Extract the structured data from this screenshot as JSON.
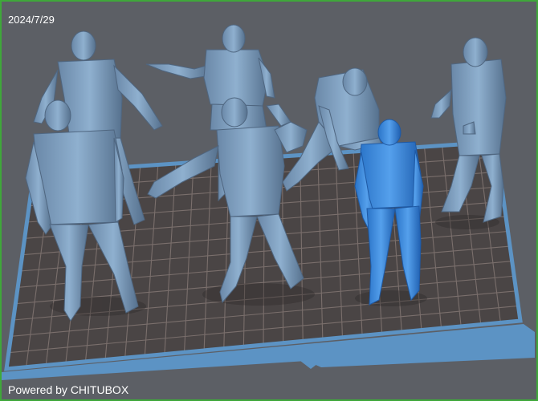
{
  "viewport": {
    "date": "2024/7/29",
    "powered_by": "Powered by CHITUBOX"
  },
  "scene": {
    "build_plate": "build-plate",
    "models": [
      {
        "name": "figure-model-1",
        "selected": false
      },
      {
        "name": "figure-model-2",
        "selected": false
      },
      {
        "name": "figure-model-3",
        "selected": false
      },
      {
        "name": "figure-model-4",
        "selected": false
      },
      {
        "name": "figure-model-5",
        "selected": false
      },
      {
        "name": "figure-model-6",
        "selected": false
      },
      {
        "name": "figure-model-7",
        "selected": true
      }
    ],
    "colors": {
      "background": "#5c5f65",
      "plate": "#4a4545",
      "grid_line": "#7a6f6c",
      "plate_edge": "#5c93c4",
      "model": "#7f9fbf",
      "model_shadow": "#4f6680",
      "selected_model": "#3d86d6",
      "selected_shadow": "#1f5aa5",
      "frame": "#3fa83a"
    }
  }
}
